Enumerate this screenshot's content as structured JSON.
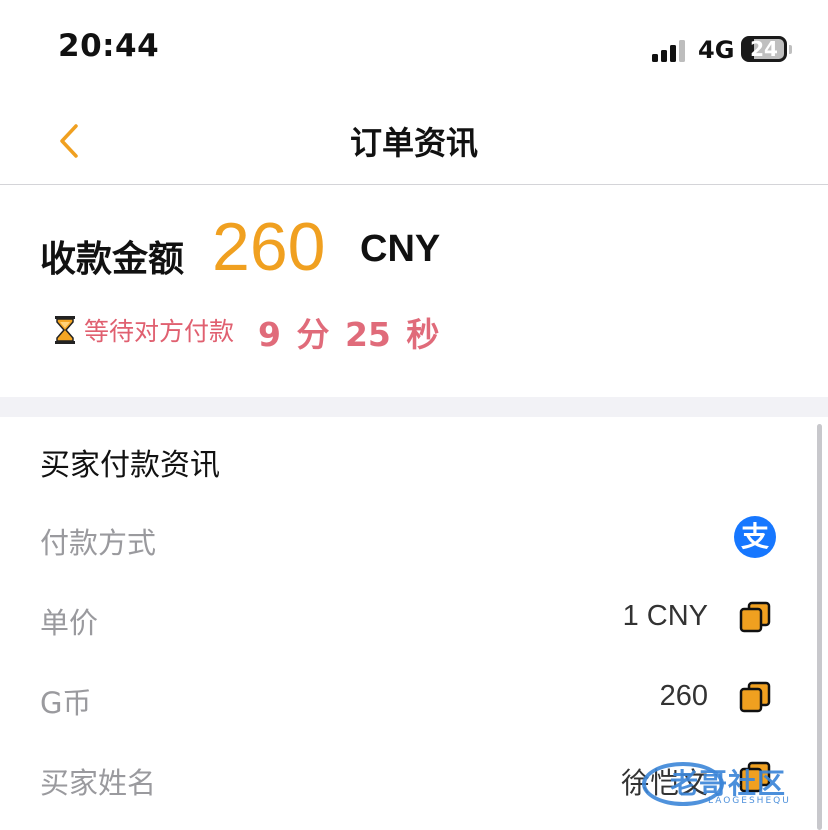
{
  "status_bar": {
    "time": "20:44",
    "network": "4G",
    "battery": "24"
  },
  "nav": {
    "title": "订单资讯",
    "back_icon": "chevron-left-icon"
  },
  "amount": {
    "label": "收款金额",
    "value": "260",
    "currency": "CNY",
    "wait_text": "等待对方付款",
    "countdown": "9 分 25 秒"
  },
  "buyer": {
    "section_title": "买家付款资讯",
    "rows": [
      {
        "label": "付款方式",
        "icon": "alipay-icon",
        "icon_glyph": "支"
      },
      {
        "label": "单价",
        "value": "1 CNY",
        "copy_icon": "copy-icon"
      },
      {
        "label": "G币",
        "value": "260",
        "copy_icon": "copy-icon"
      },
      {
        "label": "买家姓名",
        "value": "徐恺文",
        "copy_icon": "copy-icon"
      }
    ]
  },
  "watermark": {
    "text": "老哥社区",
    "subtext": "LAOGESHEQU"
  },
  "colors": {
    "accent": "#f0a020",
    "countdown": "#e06b7a",
    "alipay": "#1677ff"
  }
}
